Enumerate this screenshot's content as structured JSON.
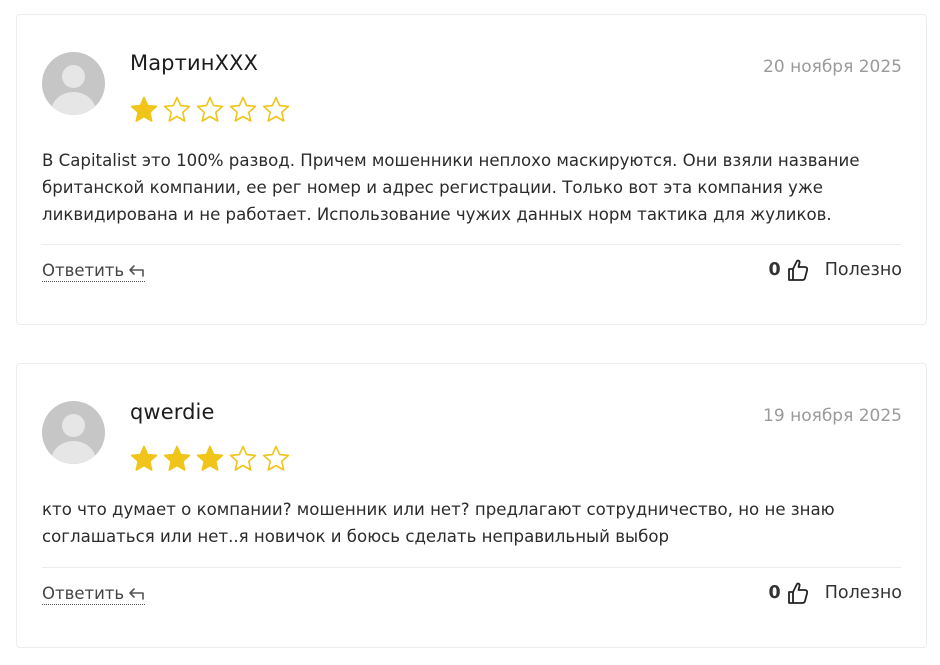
{
  "reviews": [
    {
      "author": "МартинXXX",
      "date": "20 ноября 2025",
      "rating": 1,
      "max_rating": 5,
      "text": "В Capitalist это 100% развод. Причем мошенники неплохо маскируются. Они взяли название британской компании, ее рег номер и адрес регистрации. Только вот эта компания уже ликвидирована и не работает. Использование чужих данных норм тактика для жуликов.",
      "reply_label": "Ответить",
      "helpful_count": "0",
      "helpful_label": "Полезно"
    },
    {
      "author": "qwerdie",
      "date": "19 ноября 2025",
      "rating": 3,
      "max_rating": 5,
      "text": "кто что думает о компании? мошенник или нет? предлагают сотрудничество, но не знаю соглашаться или нет..я новичок и боюсь сделать неправильный выбор",
      "reply_label": "Ответить",
      "helpful_count": "0",
      "helpful_label": "Полезно"
    }
  ],
  "colors": {
    "star_filled": "#f0c419",
    "star_outline": "#f0c419",
    "avatar_bg": "#c6c6c6",
    "date_text": "#9a9a9a"
  },
  "icons": {
    "avatar": "user-avatar-icon",
    "star": "star-icon",
    "reply": "reply-arrow-icon",
    "helpful": "thumbs-up-icon"
  }
}
